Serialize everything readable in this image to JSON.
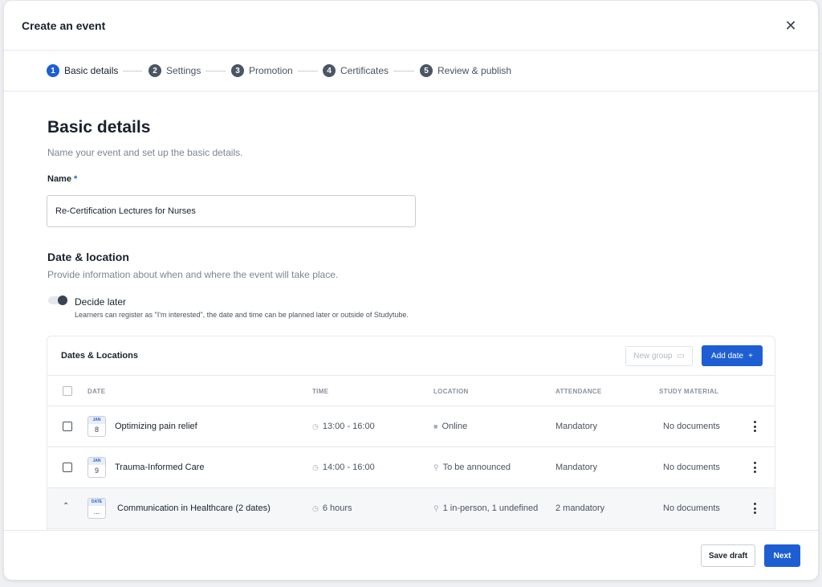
{
  "modal": {
    "title": "Create an event",
    "close_icon": "close-icon"
  },
  "steps": [
    {
      "num": "1",
      "label": "Basic details",
      "active": true
    },
    {
      "num": "2",
      "label": "Settings"
    },
    {
      "num": "3",
      "label": "Promotion"
    },
    {
      "num": "4",
      "label": "Certificates"
    },
    {
      "num": "5",
      "label": "Review & publish"
    }
  ],
  "basic": {
    "title": "Basic details",
    "subtitle": "Name your event and set up the basic details.",
    "name_label": "Name",
    "required_mark": "*",
    "name_value": "Re-Certification Lectures for Nurses"
  },
  "date_location": {
    "title": "Date & location",
    "subtitle": "Provide information about when and where the event will take place.",
    "toggle_label": "Decide later",
    "toggle_help": "Learners can register as \"I'm interested\", the date and time can be planned later or outside of Studytube."
  },
  "table": {
    "title": "Dates & Locations",
    "new_group_label": "New group",
    "add_date_label": "Add date",
    "headers": {
      "date": "DATE",
      "time": "TIME",
      "location": "LOCATION",
      "attendance": "ATTENDANCE",
      "material": "STUDY MATERIAL"
    },
    "rows": [
      {
        "cal_top": "JAN",
        "cal_day": "8",
        "title": "Optimizing pain relief",
        "time": "13:00 - 16:00",
        "location": "Online",
        "location_icon": "video-icon",
        "attendance": "Mandatory",
        "material": "No documents"
      },
      {
        "cal_top": "JAN",
        "cal_day": "9",
        "title": "Trauma-Informed Care",
        "time": "14:00 - 16:00",
        "location": "To be announced",
        "location_icon": "pin-icon",
        "attendance": "Mandatory",
        "material": "No documents"
      },
      {
        "cal_top": "DATE",
        "cal_day": "...",
        "title": "Communication in Healthcare (2 dates)",
        "time": "6 hours",
        "location": "1 in-person, 1 undefined",
        "location_icon": "pin-icon",
        "attendance": "2 mandatory",
        "material": "No documents"
      }
    ]
  },
  "footer": {
    "save_label": "Save draft",
    "next_label": "Next"
  },
  "colors": {
    "accent": "#1d5fd3",
    "text": "#18222d",
    "muted": "#7d8591",
    "border": "#e6e9ed"
  }
}
